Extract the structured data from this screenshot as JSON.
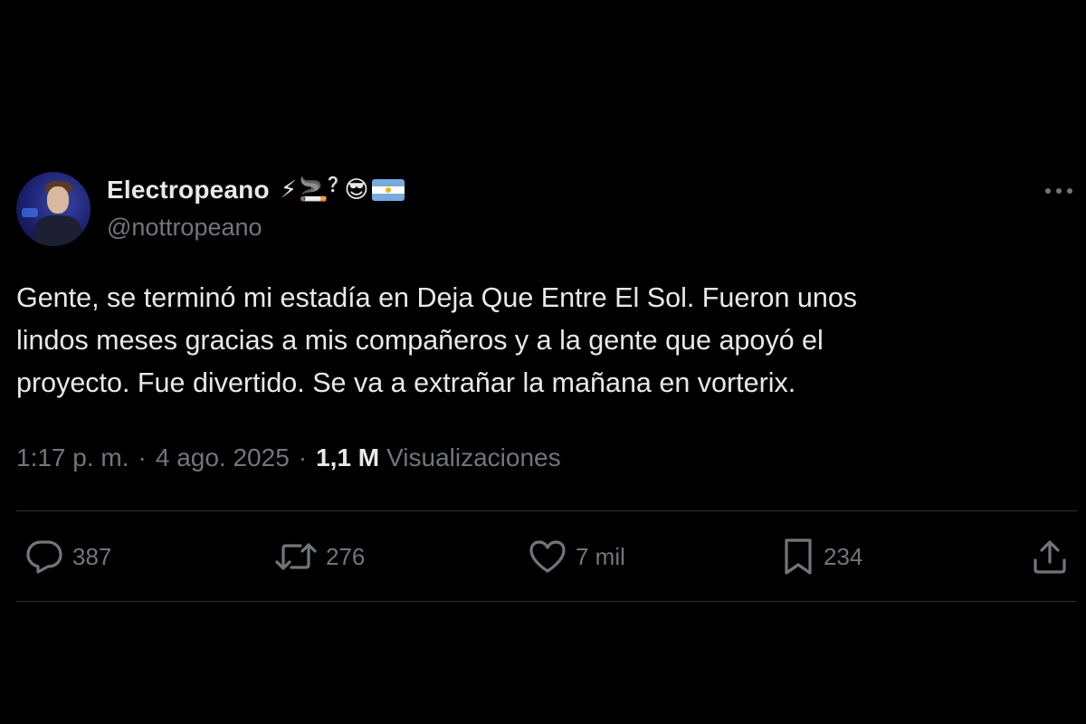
{
  "author": {
    "display_name": "Electropeano",
    "handle": "@nottropeano",
    "name_emojis": [
      "⚡",
      "🚬",
      "❔",
      "😎"
    ],
    "flag": "argentina-flag-icon"
  },
  "tweet": {
    "text": "Gente, se terminó mi estadía en Deja Que Entre El Sol. Fueron unos\nlindos meses gracias a mis compañeros y a la gente que apoyó el\nproyecto. Fue divertido. Se va a extrañar la mañana en vorterix.",
    "time": "1:17 p. m.",
    "separator": "·",
    "date": "4 ago. 2025",
    "views_count": "1,1 M",
    "views_label": "Visualizaciones"
  },
  "actions": {
    "replies": "387",
    "reposts": "276",
    "likes": "7 mil",
    "bookmarks": "234"
  },
  "icons": {
    "more": "more-horizontal-icon",
    "reply": "reply-bubble-icon",
    "repost": "repost-arrows-icon",
    "like": "heart-icon",
    "bookmark": "bookmark-icon",
    "share": "share-upload-icon"
  },
  "colors": {
    "background": "#000000",
    "primary_text": "#e7e9ea",
    "secondary_text": "#71767b",
    "divider": "#2f3336"
  }
}
